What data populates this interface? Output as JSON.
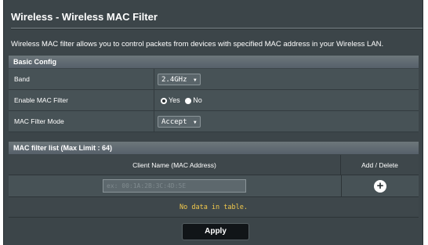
{
  "page": {
    "title": "Wireless - Wireless MAC Filter",
    "description": "Wireless MAC filter allows you to control packets from devices with specified MAC address in your Wireless LAN."
  },
  "basic_config": {
    "header": "Basic Config",
    "band": {
      "label": "Band",
      "value": "2.4GHz"
    },
    "enable_mac_filter": {
      "label": "Enable MAC Filter",
      "options": [
        "Yes",
        "No"
      ],
      "selected": "Yes"
    },
    "mac_filter_mode": {
      "label": "MAC Filter Mode",
      "value": "Accept"
    }
  },
  "mac_list": {
    "header": "MAC filter list (Max Limit : 64)",
    "columns": [
      "Client Name (MAC Address)",
      "Add / Delete"
    ],
    "input_placeholder": "ex: 00:1A:2B:3C:4D:5E",
    "empty_message": "No data in table."
  },
  "actions": {
    "apply_label": "Apply"
  },
  "icons": {
    "add": "plus-circle-icon",
    "dropdown": "triangle-down-icon"
  }
}
